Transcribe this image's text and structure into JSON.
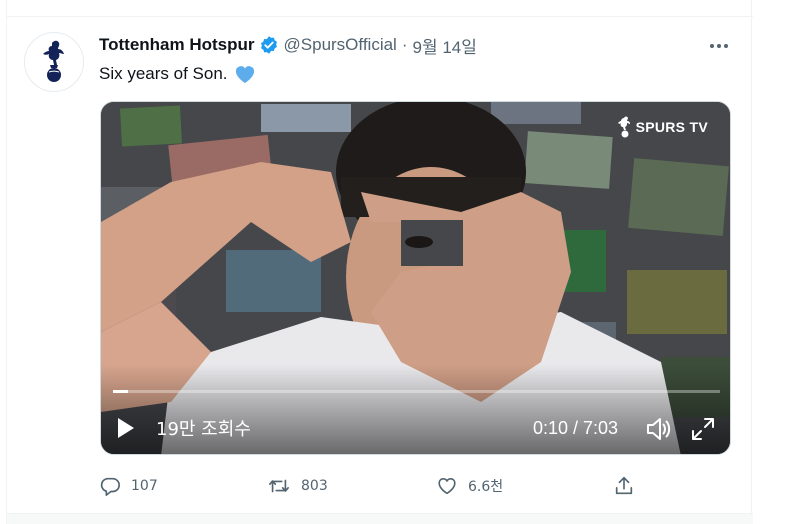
{
  "tweet": {
    "author_name": "Tottenham Hotspur",
    "handle": "@SpursOfficial",
    "separator": "·",
    "date": "9월 14일",
    "text": "Six years of Son.",
    "more_label": "···"
  },
  "video": {
    "badge": "SPURS TV",
    "views": "19만 조회수",
    "time": "0:10 / 7:03",
    "progress_fraction": 0.024
  },
  "actions": {
    "reply_count": "107",
    "retweet_count": "803",
    "like_count": "6.6천"
  },
  "colors": {
    "verified": "#1d9bf0",
    "heart_emoji": "#5dadec",
    "muted_text": "#536471"
  }
}
